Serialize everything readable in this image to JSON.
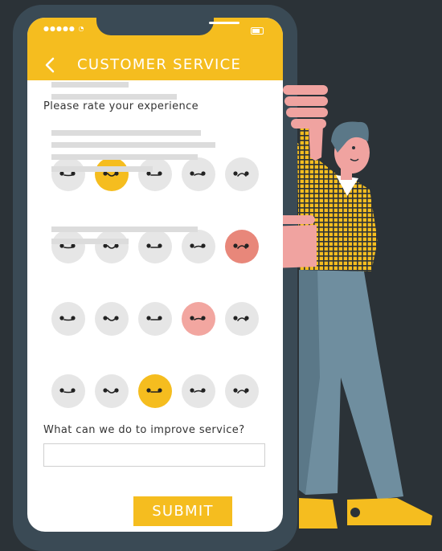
{
  "colors": {
    "background": "#2b3237",
    "phone_frame": "#3a4a55",
    "accent": "#f5bd1f",
    "selected_sad": "#e8877a",
    "selected_neutral": "#f2a6a0",
    "face_default": "#e6e6e6"
  },
  "status_bar": {
    "signal": "●●●●● ◔",
    "battery_icon": "battery-icon"
  },
  "header": {
    "title": "CUSTOMER SERVICE",
    "back_icon": "chevron-left-icon"
  },
  "survey": {
    "prompt": "Please rate your experience",
    "questions": [
      {
        "selected": 1
      },
      {
        "selected": 4
      },
      {
        "selected": 3
      },
      {
        "selected": 2
      }
    ],
    "face_icons": [
      "very-happy-face-icon",
      "happy-face-icon",
      "neutral-face-icon",
      "unhappy-face-icon",
      "sad-face-icon"
    ]
  },
  "improve": {
    "question": "What can we do to improve service?",
    "placeholder": "",
    "value": ""
  },
  "submit_label": "SUBMIT"
}
